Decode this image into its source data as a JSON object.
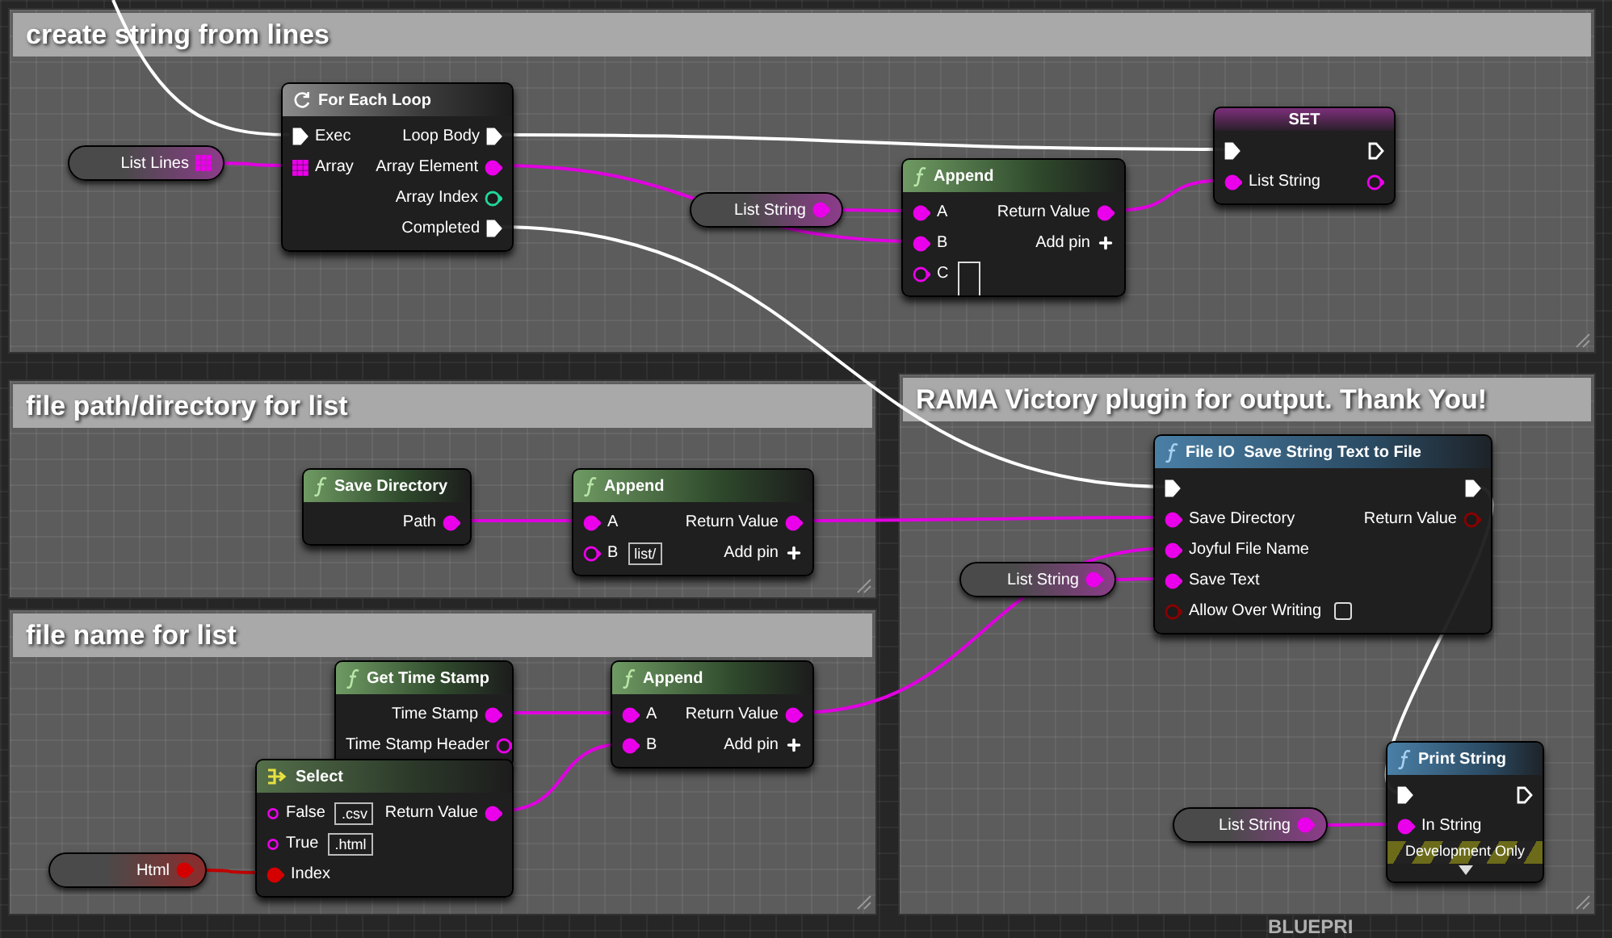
{
  "comments": [
    {
      "title": "create string from lines",
      "nodes": [
        {
          "kind": "variable",
          "label": "List Lines",
          "pin": {
            "kind": "array",
            "connected": true
          }
        },
        {
          "kind": "macro",
          "title": "For Each Loop",
          "rows": [
            {
              "left": {
                "kind": "exec",
                "label": "Exec",
                "connected": true
              },
              "right": {
                "kind": "exec",
                "label": "Loop Body",
                "connected": true
              }
            },
            {
              "left": {
                "kind": "array",
                "label": "Array",
                "connected": true
              },
              "right": {
                "kind": "string",
                "label": "Array Element",
                "connected": true
              }
            },
            {
              "right": {
                "kind": "int",
                "label": "Array Index",
                "connected": false
              }
            },
            {
              "right": {
                "kind": "exec",
                "label": "Completed",
                "connected": true
              }
            }
          ]
        },
        {
          "kind": "variable",
          "label": "List String",
          "pin": {
            "kind": "string",
            "connected": true
          }
        },
        {
          "kind": "pure",
          "title": "Append",
          "rows": [
            {
              "left": {
                "kind": "string",
                "label": "A",
                "connected": true
              },
              "right": {
                "kind": "string",
                "label": "Return Value",
                "connected": true
              }
            },
            {
              "left": {
                "kind": "string",
                "label": "B",
                "connected": true
              },
              "right": {
                "kind": "add",
                "label": "Add pin"
              }
            },
            {
              "left": {
                "kind": "string",
                "label": "C",
                "connected": false,
                "field": true
              }
            }
          ]
        },
        {
          "kind": "set",
          "title": "SET",
          "rows": [
            {
              "left": {
                "kind": "exec",
                "connected": true
              },
              "right": {
                "kind": "exec",
                "connected": false
              }
            },
            {
              "left": {
                "kind": "string",
                "label": "List String",
                "connected": true
              },
              "right": {
                "kind": "string",
                "connected": false
              }
            }
          ]
        }
      ]
    },
    {
      "title": "file path/directory for list",
      "nodes": [
        {
          "kind": "pure",
          "title": "Save Directory",
          "rows": [
            {
              "right": {
                "kind": "string",
                "label": "Path",
                "connected": true
              }
            }
          ]
        },
        {
          "kind": "pure",
          "title": "Append",
          "rows": [
            {
              "left": {
                "kind": "string",
                "label": "A",
                "connected": true
              },
              "right": {
                "kind": "string",
                "label": "Return Value",
                "connected": true
              }
            },
            {
              "left": {
                "kind": "string",
                "label": "B",
                "connected": false,
                "default": "list/"
              },
              "right": {
                "kind": "add",
                "label": "Add pin"
              }
            }
          ]
        }
      ]
    },
    {
      "title": "file name for list",
      "nodes": [
        {
          "kind": "pure",
          "title": "Get Time Stamp",
          "rows": [
            {
              "right": {
                "kind": "string",
                "label": "Time Stamp",
                "connected": true
              }
            },
            {
              "right": {
                "kind": "string",
                "label": "Time Stamp Header",
                "connected": false
              }
            }
          ]
        },
        {
          "kind": "pure",
          "title": "Append",
          "rows": [
            {
              "left": {
                "kind": "string",
                "label": "A",
                "connected": true
              },
              "right": {
                "kind": "string",
                "label": "Return Value",
                "connected": true
              }
            },
            {
              "left": {
                "kind": "string",
                "label": "B",
                "connected": true
              },
              "right": {
                "kind": "add",
                "label": "Add pin"
              }
            }
          ]
        },
        {
          "kind": "variable",
          "label": "Html",
          "pin": {
            "kind": "byte",
            "connected": true
          }
        },
        {
          "kind": "select",
          "title": "Select",
          "rows": [
            {
              "left": {
                "kind": "option",
                "label": "False",
                "connected": false,
                "default": ".csv"
              },
              "right": {
                "kind": "string",
                "label": "Return Value",
                "connected": true
              }
            },
            {
              "left": {
                "kind": "option",
                "label": "True",
                "connected": false,
                "default": ".html"
              }
            },
            {
              "left": {
                "kind": "byte",
                "label": "Index",
                "connected": true
              }
            }
          ]
        }
      ]
    },
    {
      "title": "RAMA Victory plugin for output. Thank You!",
      "nodes": [
        {
          "kind": "variable",
          "label": "List String",
          "pin": {
            "kind": "string",
            "connected": true
          }
        },
        {
          "kind": "impure",
          "title": "File IO  Save String Text to File",
          "rows": [
            {
              "left": {
                "kind": "exec",
                "connected": true
              },
              "right": {
                "kind": "exec",
                "connected": true
              }
            },
            {
              "left": {
                "kind": "string",
                "label": "Save Directory",
                "connected": true
              },
              "right": {
                "kind": "bool",
                "label": "Return Value",
                "connected": false
              }
            },
            {
              "left": {
                "kind": "string",
                "label": "Joyful File Name",
                "connected": true
              }
            },
            {
              "left": {
                "kind": "string",
                "label": "Save Text",
                "connected": true
              }
            },
            {
              "left": {
                "kind": "bool",
                "label": "Allow Over Writing",
                "connected": false,
                "checkbox": {
                  "checked": false
                }
              }
            }
          ]
        },
        {
          "kind": "variable",
          "label": "List String",
          "pin": {
            "kind": "string",
            "connected": true
          }
        },
        {
          "kind": "impure",
          "title": "Print String",
          "rows": [
            {
              "left": {
                "kind": "exec",
                "connected": true
              },
              "right": {
                "kind": "exec",
                "connected": false
              }
            },
            {
              "left": {
                "kind": "string",
                "label": "In String",
                "connected": true
              }
            }
          ],
          "badge": "Development Only"
        }
      ]
    }
  ],
  "background_label": "BLUEPRI"
}
